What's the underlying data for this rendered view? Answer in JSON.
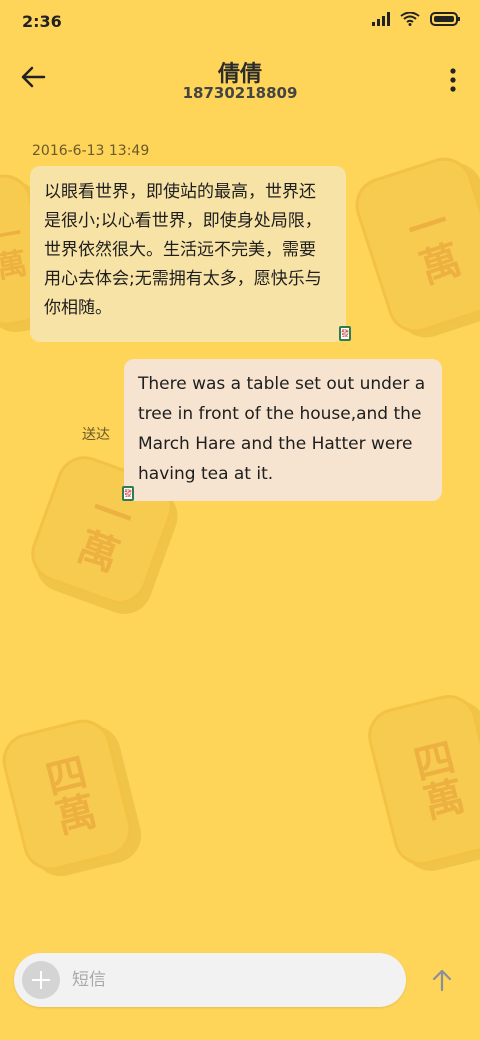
{
  "status_bar": {
    "time": "2:36",
    "icons": [
      "signal-icon",
      "wifi-icon",
      "battery-icon"
    ]
  },
  "header": {
    "back_icon": "back-arrow-icon",
    "contact_name": "倩倩",
    "contact_number": "18730218809",
    "more_icon": "more-vertical-icon"
  },
  "conversation": {
    "timestamp": "2016-6-13 13:49",
    "messages": [
      {
        "direction": "incoming",
        "text": "以眼看世界，即使站的最高，世界还是很小;以心看世界，即使身处局限，世界依然很大。生活远不完美，需要用心去体会;无需拥有太多，愿快乐与你相随。",
        "sim_badge": "發"
      },
      {
        "direction": "outgoing",
        "text": "There was a table set out under a tree in front of the house,and the March Hare and the Hatter were having tea at it.",
        "status": "送达",
        "sim_badge": "發"
      }
    ]
  },
  "background_tiles": [
    "一萬",
    "一萬",
    "一萬",
    "四萬",
    "四萬"
  ],
  "composer": {
    "add_icon": "plus-icon",
    "placeholder": "短信",
    "send_icon": "send-arrow-icon"
  },
  "colors": {
    "background": "#fed459",
    "incoming_bubble": "#f8e3a6",
    "outgoing_bubble": "#f6e4d0"
  }
}
